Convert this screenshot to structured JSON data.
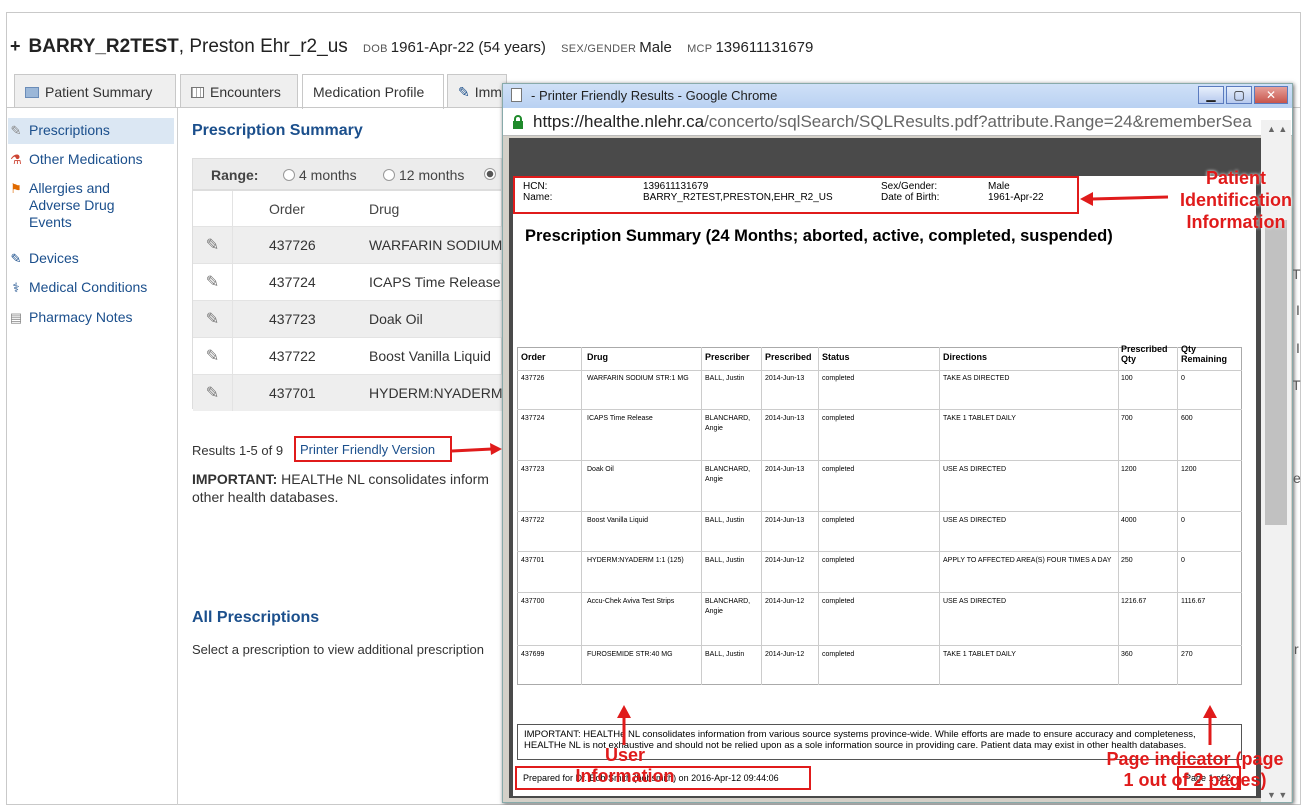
{
  "header": {
    "plus": "+",
    "surname": "BARRY_R2TEST",
    "given": ", Preston Ehr_r2_us",
    "dob_label": "DOB",
    "dob_value": "1961-Apr-22 (54 years)",
    "sex_label": "SEX/GENDER",
    "sex_value": "Male",
    "mcp_label": "MCP",
    "mcp_value": "139611131679"
  },
  "tabs": [
    "Patient Summary",
    "Encounters",
    "Medication Profile",
    "Imm"
  ],
  "sidebar": {
    "items": [
      {
        "label": "Prescriptions",
        "icon": "prescription-icon"
      },
      {
        "label": "Other Medications",
        "icon": "medication-bottle-icon"
      },
      {
        "label": "Allergies and",
        "label2": "Adverse Drug",
        "label3": "Events",
        "icon": "flag-icon"
      },
      {
        "label": "Devices",
        "icon": "device-icon"
      },
      {
        "label": "Medical Conditions",
        "icon": "medical-condition-icon"
      },
      {
        "label": "Pharmacy Notes",
        "icon": "notes-icon"
      }
    ]
  },
  "main": {
    "summary_title": "Prescription Summary",
    "range_label": "Range:",
    "range_options": [
      "4 months",
      "12 months"
    ],
    "table_headers": [
      "Order",
      "Drug"
    ],
    "rows": [
      {
        "order": "437726",
        "drug": "WARFARIN SODIUM"
      },
      {
        "order": "437724",
        "drug": "ICAPS Time Release"
      },
      {
        "order": "437723",
        "drug": "Doak Oil"
      },
      {
        "order": "437722",
        "drug": "Boost Vanilla Liquid"
      },
      {
        "order": "437701",
        "drug": "HYDERM:NYADERM"
      }
    ],
    "results_text": "Results 1-5 of 9",
    "printer_link": "Printer Friendly Version",
    "important_bold": "IMPORTANT:",
    "important_text": " HEALTHe NL consolidates inform",
    "important_text2": "other health databases.",
    "all_title": "All Prescriptions",
    "all_desc": "Select a prescription to view additional prescription"
  },
  "popup": {
    "title": "- Printer Friendly Results - Google Chrome",
    "url_host": "https://healthe.nlehr.ca",
    "url_path": "/concerto/sqlSearch/SQLResults.pdf?attribute.Range=24&rememberSea",
    "pdf": {
      "hcn_label": "HCN:",
      "hcn_value": "139611131679",
      "name_label": "Name:",
      "name_value": "BARRY_R2TEST,PRESTON,EHR_R2_US",
      "sex_label": "Sex/Gender:",
      "sex_value": "Male",
      "dob_label": "Date of Birth:",
      "dob_value": "1961-Apr-22",
      "heading": "Prescription Summary (24 Months; aborted, active, completed, suspended)",
      "headers": [
        "Order",
        "Drug",
        "Prescriber",
        "Prescribed",
        "Status",
        "Directions",
        "Prescribed Qty",
        "Qty Remaining"
      ],
      "rows": [
        {
          "order": "437726",
          "drug": "WARFARIN SODIUM STR:1 MG",
          "prescriber": "BALL, Justin",
          "prescriber2": "",
          "date": "2014-Jun-13",
          "status": "completed",
          "directions": "TAKE AS DIRECTED",
          "pqty": "100",
          "rqty": "0"
        },
        {
          "order": "437724",
          "drug": "ICAPS Time Release",
          "prescriber": "BLANCHARD,",
          "prescriber2": "Angie",
          "date": "2014-Jun-13",
          "status": "completed",
          "directions": "TAKE 1 TABLET DAILY",
          "pqty": "700",
          "rqty": "600"
        },
        {
          "order": "437723",
          "drug": "Doak Oil",
          "prescriber": "BLANCHARD,",
          "prescriber2": "Angie",
          "date": "2014-Jun-13",
          "status": "completed",
          "directions": "USE AS DIRECTED",
          "pqty": "1200",
          "rqty": "1200"
        },
        {
          "order": "437722",
          "drug": "Boost Vanilla Liquid",
          "prescriber": "BALL, Justin",
          "prescriber2": "",
          "date": "2014-Jun-13",
          "status": "completed",
          "directions": "USE AS DIRECTED",
          "pqty": "4000",
          "rqty": "0"
        },
        {
          "order": "437701",
          "drug": "HYDERM:NYADERM 1:1 (125)",
          "prescriber": "BALL, Justin",
          "prescriber2": "",
          "date": "2014-Jun-12",
          "status": "completed",
          "directions": "APPLY TO AFFECTED AREA(S) FOUR TIMES A DAY",
          "pqty": "250",
          "rqty": "0"
        },
        {
          "order": "437700",
          "drug": "Accu-Chek Aviva Test Strips",
          "prescriber": "BLANCHARD,",
          "prescriber2": "Angie",
          "date": "2014-Jun-12",
          "status": "completed",
          "directions": "USE AS DIRECTED",
          "pqty": "1216.67",
          "rqty": "1116.67"
        },
        {
          "order": "437699",
          "drug": "FUROSEMIDE STR:40 MG",
          "prescriber": "BALL, Justin",
          "prescriber2": "",
          "date": "2014-Jun-12",
          "status": "completed",
          "directions": "TAKE 1 TABLET DAILY",
          "pqty": "360",
          "rqty": "270"
        }
      ],
      "important": "IMPORTANT: HEALTHe NL consolidates information from various source systems province-wide. While efforts are made to ensure accuracy and completeness, HEALTHe NL is not exhaustive and should not be relied upon as a sole information source in providing care. Patient data may exist in other health databases.",
      "prepared": "Prepared for Dr. Bob Smith (bobsmith) on 2016-Apr-12 09:44:06",
      "page": "Page 1 of 2"
    }
  },
  "annotations": {
    "patient_id": "Patient Identification Information",
    "patient_id_l1": "Patient",
    "patient_id_l2": "Identification",
    "patient_id_l3": "Information",
    "user_l1": "User",
    "user_l2": "Information",
    "page_l1": "Page indicator (page",
    "page_l2": "1 out of 2 pages)",
    "color": "#e01b1b"
  }
}
